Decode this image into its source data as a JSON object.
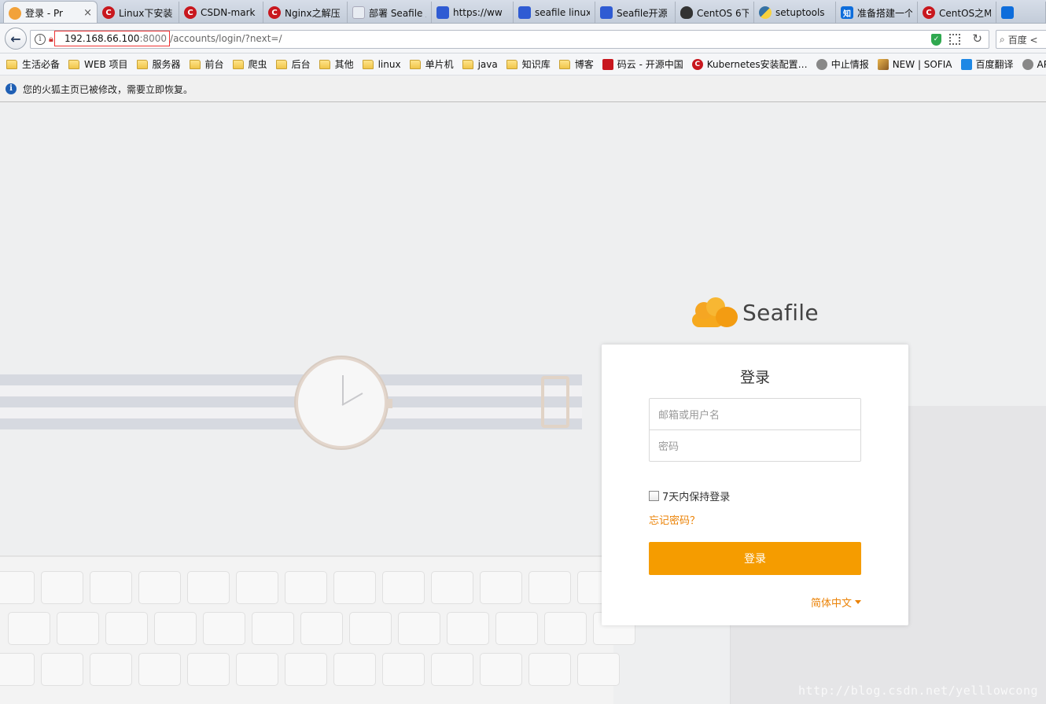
{
  "tabs": [
    {
      "label": "登录 - Pr",
      "icon": "sea",
      "active": true,
      "close": "×"
    },
    {
      "label": "Linux下安装",
      "icon": "csdn"
    },
    {
      "label": "CSDN-mark",
      "icon": "csdn"
    },
    {
      "label": "Nginx之解压",
      "icon": "csdn"
    },
    {
      "label": "部署 Seafile 服务",
      "icon": "blank"
    },
    {
      "label": "https://ww",
      "icon": "paw"
    },
    {
      "label": "seafile linux",
      "icon": "paw"
    },
    {
      "label": "Seafile开源",
      "icon": "paw"
    },
    {
      "label": "CentOS 6下",
      "icon": "linux"
    },
    {
      "label": "setuptools",
      "icon": "py"
    },
    {
      "label": "准备搭建一个",
      "icon": "zhi"
    },
    {
      "label": "CentOS之M",
      "icon": "csdn"
    }
  ],
  "zhi_glyph": "知",
  "nav": {
    "url_host": "192.168.66.100",
    "url_port": ":8000",
    "url_path": "/accounts/login/?next=/",
    "search_label": "百度 <"
  },
  "bookmarks": [
    {
      "label": "生活必备",
      "type": "folder"
    },
    {
      "label": "WEB 项目",
      "type": "folder"
    },
    {
      "label": "服务器",
      "type": "folder"
    },
    {
      "label": "前台",
      "type": "folder"
    },
    {
      "label": "爬虫",
      "type": "folder"
    },
    {
      "label": "后台",
      "type": "folder"
    },
    {
      "label": "其他",
      "type": "folder"
    },
    {
      "label": "linux",
      "type": "folder"
    },
    {
      "label": "单片机",
      "type": "folder"
    },
    {
      "label": "java",
      "type": "folder"
    },
    {
      "label": "知识库",
      "type": "folder"
    },
    {
      "label": "博客",
      "type": "folder"
    },
    {
      "label": "码云 - 开源中国",
      "type": "red"
    },
    {
      "label": "Kubernetes安装配置…",
      "type": "csdn"
    },
    {
      "label": "中止情报",
      "type": "globe"
    },
    {
      "label": "NEW | SOFIA",
      "type": "img"
    },
    {
      "label": "百度翻译",
      "type": "fy"
    },
    {
      "label": "API",
      "type": "globe"
    }
  ],
  "notice": {
    "text": "您的火狐主页已被修改，需要立即恢复。"
  },
  "logo": {
    "text": "Seafile"
  },
  "login": {
    "title": "登录",
    "username_placeholder": "邮箱或用户名",
    "password_placeholder": "密码",
    "remember_label": "7天内保持登录",
    "forgot_label": "忘记密码？",
    "submit_label": "登录",
    "language_label": "简体中文"
  },
  "watermark": "http://blog.csdn.net/yelllowcong",
  "colors": {
    "accent": "#f59c00",
    "link": "#eb8205",
    "url_highlight": "#e33333"
  }
}
